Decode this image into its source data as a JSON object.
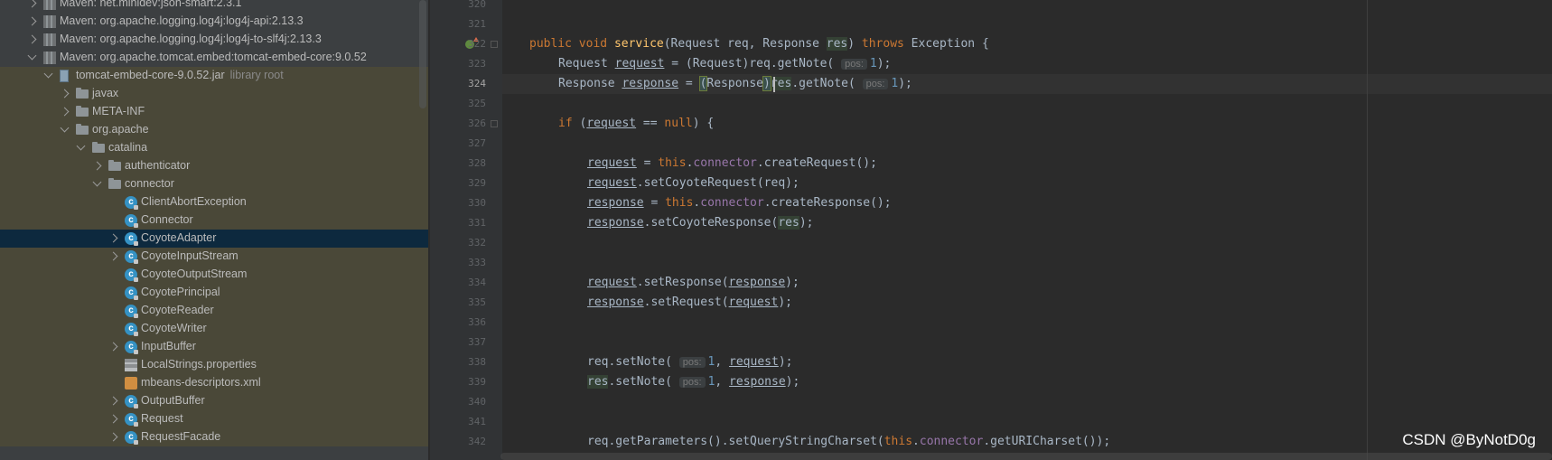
{
  "project_tree": {
    "rows": [
      {
        "label": "Maven: net.minidev:json-smart:2.3.1",
        "sub": "",
        "icon": "library-icon",
        "chevron": "right"
      },
      {
        "label": "Maven: org.apache.logging.log4j:log4j-api:2.13.3",
        "sub": "",
        "icon": "library-icon",
        "chevron": "right"
      },
      {
        "label": "Maven: org.apache.logging.log4j:log4j-to-slf4j:2.13.3",
        "sub": "",
        "icon": "library-icon",
        "chevron": "right"
      },
      {
        "label": "Maven: org.apache.tomcat.embed:tomcat-embed-core:9.0.52",
        "sub": "",
        "icon": "library-icon",
        "chevron": "down"
      },
      {
        "label": "tomcat-embed-core-9.0.52.jar",
        "sub": "library root",
        "icon": "jar-icon",
        "chevron": "down"
      },
      {
        "label": "javax",
        "sub": "",
        "icon": "folder-icon",
        "chevron": "right"
      },
      {
        "label": "META-INF",
        "sub": "",
        "icon": "folder-icon",
        "chevron": "right"
      },
      {
        "label": "org.apache",
        "sub": "",
        "icon": "folder-icon",
        "chevron": "down"
      },
      {
        "label": "catalina",
        "sub": "",
        "icon": "folder-icon",
        "chevron": "down"
      },
      {
        "label": "authenticator",
        "sub": "",
        "icon": "folder-icon",
        "chevron": "right"
      },
      {
        "label": "connector",
        "sub": "",
        "icon": "folder-icon",
        "chevron": "down"
      },
      {
        "label": "ClientAbortException",
        "sub": "",
        "icon": "class-icon",
        "chevron": ""
      },
      {
        "label": "Connector",
        "sub": "",
        "icon": "class-icon",
        "chevron": ""
      },
      {
        "label": "CoyoteAdapter",
        "sub": "",
        "icon": "class-icon",
        "chevron": "right"
      },
      {
        "label": "CoyoteInputStream",
        "sub": "",
        "icon": "class-icon",
        "chevron": "right"
      },
      {
        "label": "CoyoteOutputStream",
        "sub": "",
        "icon": "class-icon",
        "chevron": ""
      },
      {
        "label": "CoyotePrincipal",
        "sub": "",
        "icon": "class-icon",
        "chevron": ""
      },
      {
        "label": "CoyoteReader",
        "sub": "",
        "icon": "class-icon",
        "chevron": ""
      },
      {
        "label": "CoyoteWriter",
        "sub": "",
        "icon": "class-icon",
        "chevron": ""
      },
      {
        "label": "InputBuffer",
        "sub": "",
        "icon": "class-icon",
        "chevron": "right"
      },
      {
        "label": "LocalStrings.properties",
        "sub": "",
        "icon": "properties-icon",
        "chevron": ""
      },
      {
        "label": "mbeans-descriptors.xml",
        "sub": "",
        "icon": "xml-icon",
        "chevron": ""
      },
      {
        "label": "OutputBuffer",
        "sub": "",
        "icon": "class-icon",
        "chevron": "right"
      },
      {
        "label": "Request",
        "sub": "",
        "icon": "class-icon",
        "chevron": "right"
      },
      {
        "label": "RequestFacade",
        "sub": "",
        "icon": "class-icon",
        "chevron": "right"
      }
    ],
    "selected": "CoyoteAdapter"
  },
  "editor": {
    "current_line": "324",
    "line_numbers": [
      "320",
      "321",
      "322",
      "323",
      "324",
      "325",
      "326",
      "327",
      "328",
      "329",
      "330",
      "331",
      "332",
      "333",
      "334",
      "335",
      "336",
      "337",
      "338",
      "339",
      "340",
      "341",
      "342"
    ],
    "lines": {
      "l322": {
        "kw1": "public",
        "kw2": "void",
        "fn": "service",
        "p1": "(Request req, Response ",
        "res": "res",
        "p2": ") ",
        "throws": "throws",
        "p3": " Exception {"
      },
      "l323": {
        "t1": "Request ",
        "v": "request",
        "t2": " = (Request)req.getNote(",
        "hint": "pos:",
        "num": "1",
        "t3": ");"
      },
      "l324": {
        "t1": "Response ",
        "v": "response",
        "t2": " = ",
        "b1": "(",
        "t3": "Response",
        "b2": ")",
        "res": "res",
        "t4": ".getNote(",
        "hint": "pos:",
        "num": "1",
        "t5": ");"
      },
      "l326": {
        "kw": "if",
        "t1": " (",
        "v": "request",
        "t2": " == ",
        "null": "null",
        "t3": ") {"
      },
      "l328": {
        "v": "request",
        "t1": " = ",
        "this": "this",
        "t2": ".",
        "fld": "connector",
        "t3": ".createRequest();"
      },
      "l329": {
        "v": "request",
        "t1": ".setCoyoteRequest(req);"
      },
      "l330": {
        "v": "response",
        "t1": " = ",
        "this": "this",
        "t2": ".",
        "fld": "connector",
        "t3": ".createResponse();"
      },
      "l331": {
        "v": "response",
        "t1": ".setCoyoteResponse(",
        "res": "res",
        "t2": ");"
      },
      "l334": {
        "v": "request",
        "t1": ".setResponse(",
        "v2": "response",
        "t2": ");"
      },
      "l335": {
        "v": "response",
        "t1": ".setRequest(",
        "v2": "request",
        "t2": ");"
      },
      "l338": {
        "t1": "req.setNote(",
        "hint": "pos:",
        "num": "1",
        "t2": ", ",
        "v": "request",
        "t3": ");"
      },
      "l339": {
        "res": "res",
        "t1": ".setNote(",
        "hint": "pos:",
        "num": "1",
        "t2": ", ",
        "v": "response",
        "t3": ");"
      },
      "l342": {
        "t1": "req.getParameters().setQueryStringCharset(",
        "this": "this",
        "t2": ".",
        "fld": "connector",
        "t3": ".getURICharset());"
      }
    }
  },
  "watermark": "CSDN @ByNotD0g",
  "colors": {
    "keyword": "#cc7832",
    "function": "#ffc66d",
    "field": "#9876aa",
    "number": "#6897bb",
    "text": "#a9b7c6",
    "selection": "#0d293e"
  }
}
